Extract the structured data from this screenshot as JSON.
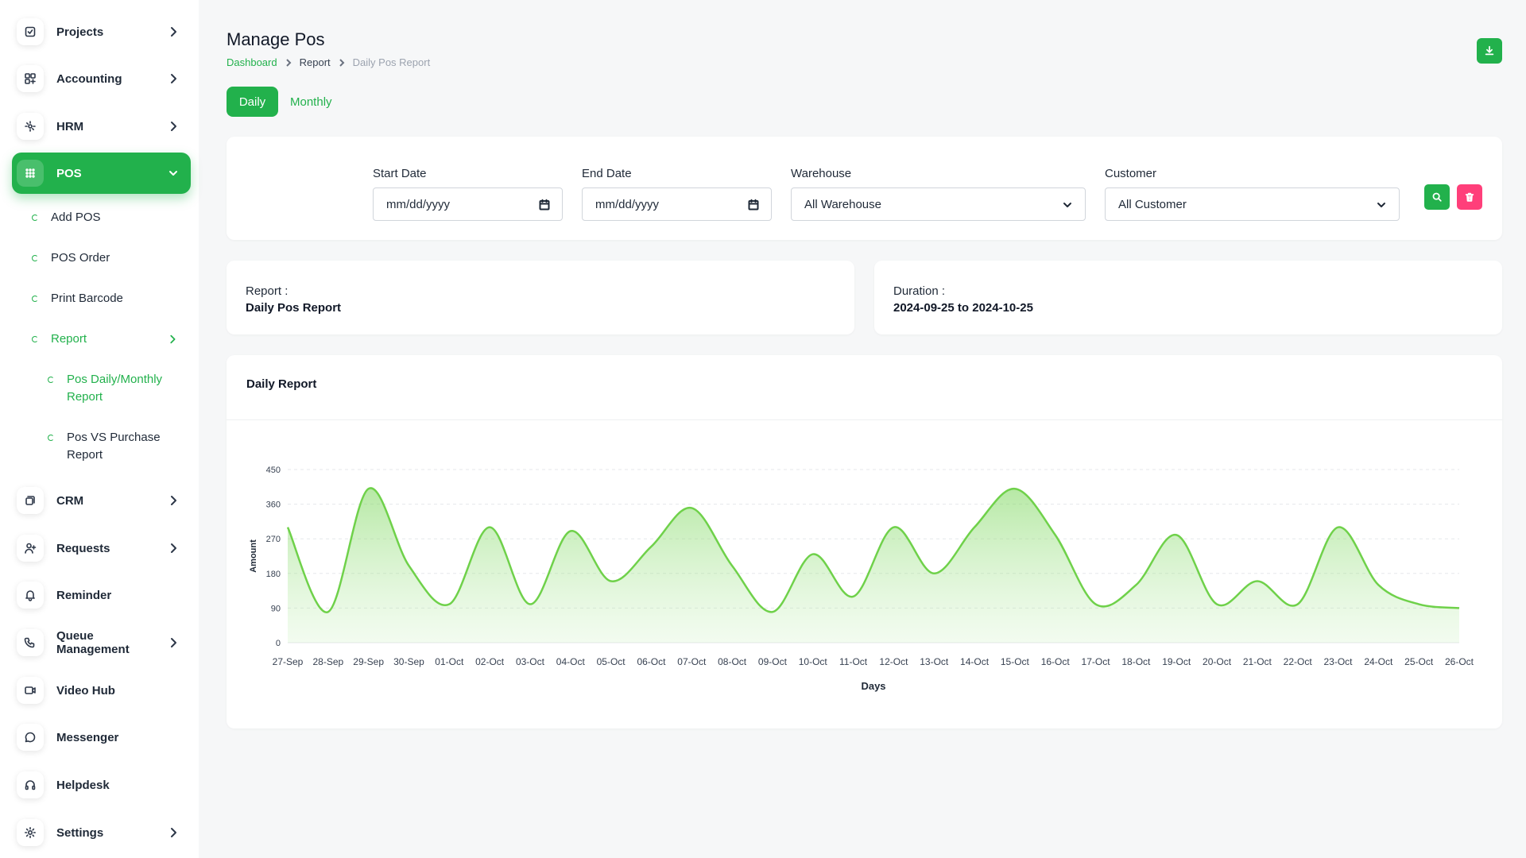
{
  "sidebar": {
    "items": [
      {
        "label": "Projects",
        "icon": "projects-icon"
      },
      {
        "label": "Accounting",
        "icon": "accounting-icon"
      },
      {
        "label": "HRM",
        "icon": "hrm-icon"
      },
      {
        "label": "POS",
        "icon": "pos-icon"
      },
      {
        "label": "CRM",
        "icon": "crm-icon"
      },
      {
        "label": "Requests",
        "icon": "requests-icon"
      },
      {
        "label": "Reminder",
        "icon": "bell-icon"
      },
      {
        "label": "Queue Management",
        "icon": "phone-icon"
      },
      {
        "label": "Video Hub",
        "icon": "video-icon"
      },
      {
        "label": "Messenger",
        "icon": "chat-icon"
      },
      {
        "label": "Helpdesk",
        "icon": "headset-icon"
      },
      {
        "label": "Settings",
        "icon": "gear-icon"
      }
    ],
    "pos_sub": [
      "Add POS",
      "POS Order",
      "Print Barcode",
      "Report"
    ],
    "report_sub": [
      "Pos Daily/Monthly Report",
      "Pos VS Purchase Report"
    ]
  },
  "header": {
    "title": "Manage Pos",
    "breadcrumb": [
      "Dashboard",
      "Report",
      "Daily Pos Report"
    ]
  },
  "tabs": [
    "Daily",
    "Monthly"
  ],
  "filters": {
    "start_label": "Start Date",
    "start_value": "mm/dd/yyyy",
    "end_label": "End Date",
    "end_value": "mm/dd/yyyy",
    "warehouse_label": "Warehouse",
    "warehouse_value": "All Warehouse",
    "customer_label": "Customer",
    "customer_value": "All Customer"
  },
  "info": {
    "report_label": "Report :",
    "report_value": "Daily Pos Report",
    "duration_label": "Duration :",
    "duration_value": "2024-09-25 to 2024-10-25"
  },
  "colors": {
    "accent": "#22b14c",
    "danger": "#ff3f7a",
    "line": "#6fd14a"
  },
  "chart_data": {
    "type": "area",
    "title": "Daily Report",
    "xlabel": "Days",
    "ylabel": "Amount",
    "ylim": [
      0,
      450
    ],
    "yticks": [
      0,
      90,
      180,
      270,
      360,
      450
    ],
    "categories": [
      "27-Sep",
      "28-Sep",
      "29-Sep",
      "30-Sep",
      "01-Oct",
      "02-Oct",
      "03-Oct",
      "04-Oct",
      "05-Oct",
      "06-Oct",
      "07-Oct",
      "08-Oct",
      "09-Oct",
      "10-Oct",
      "11-Oct",
      "12-Oct",
      "13-Oct",
      "14-Oct",
      "15-Oct",
      "16-Oct",
      "17-Oct",
      "18-Oct",
      "19-Oct",
      "20-Oct",
      "21-Oct",
      "22-Oct",
      "23-Oct",
      "24-Oct",
      "25-Oct",
      "26-Oct"
    ],
    "values": [
      300,
      80,
      400,
      200,
      100,
      300,
      100,
      290,
      160,
      250,
      350,
      200,
      80,
      230,
      120,
      300,
      180,
      300,
      400,
      280,
      100,
      150,
      280,
      100,
      160,
      100,
      300,
      150,
      100,
      90
    ],
    "grid": true
  }
}
